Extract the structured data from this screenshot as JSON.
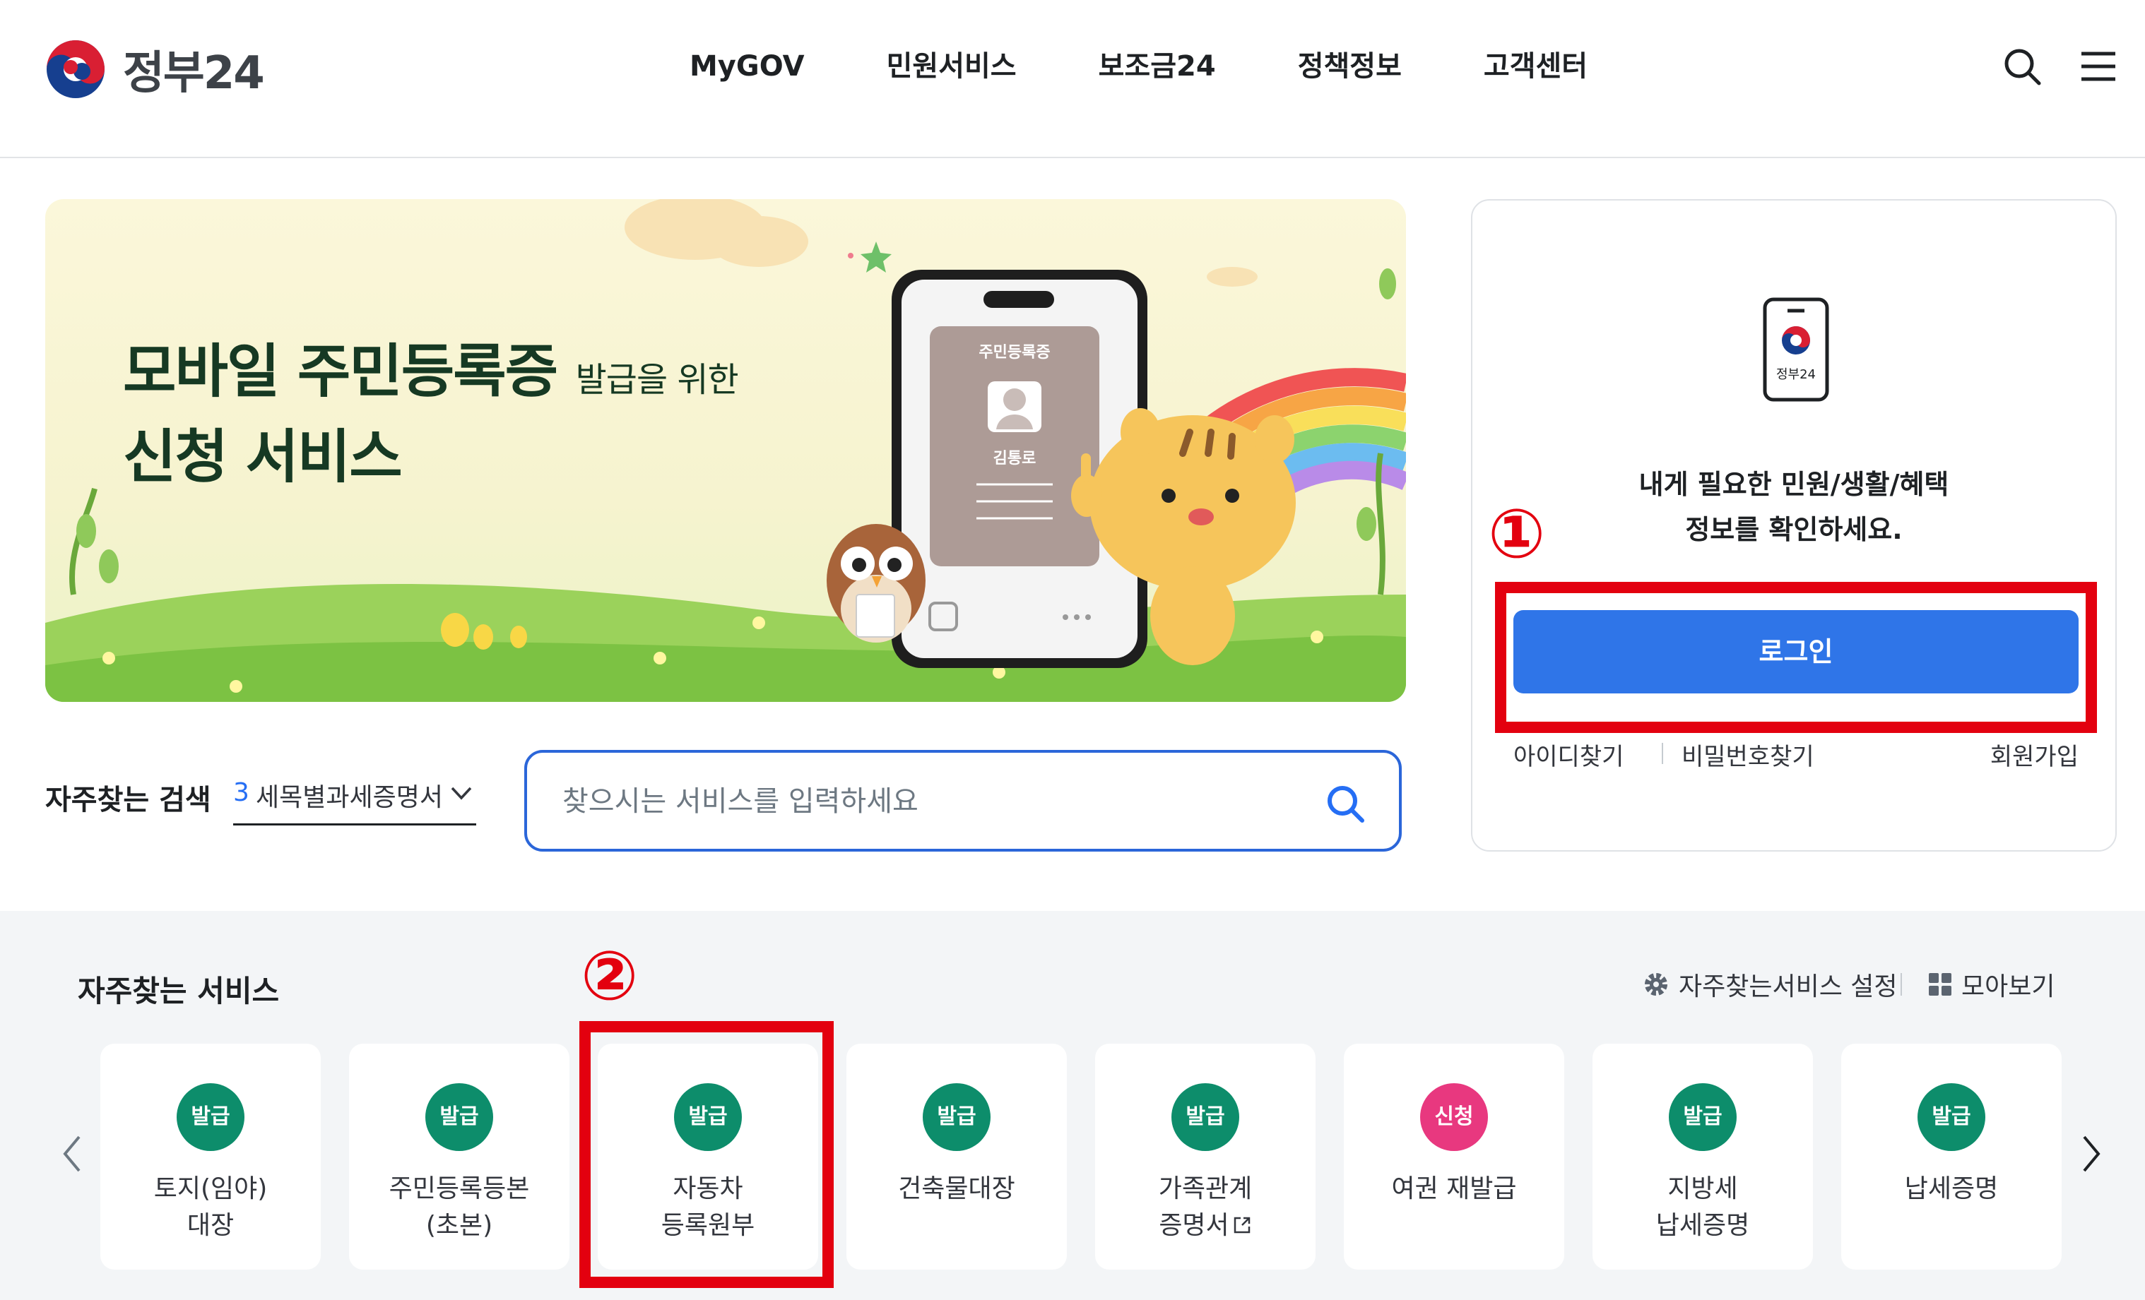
{
  "header": {
    "logo_text": "정부24",
    "nav": [
      "MyGOV",
      "민원서비스",
      "보조금24",
      "정책정보",
      "고객센터"
    ],
    "icons": [
      "search-icon",
      "menu-icon"
    ]
  },
  "banner": {
    "title_line1": "모바일 주민등록증",
    "title_line1_small": "발급을 위한",
    "title_line2": "신청 서비스",
    "card_title": "주민등록증",
    "card_name": "김통로"
  },
  "frequent_search": {
    "label": "자주찾는 검색",
    "rank": "3",
    "term": "세목별과세증명서",
    "placeholder": "찾으시는 서비스를 입력하세요"
  },
  "login": {
    "phone_icon_text": "정부24",
    "message_line1": "내게 필요한 민원/생활/혜택",
    "message_line2": "정보를 확인하세요.",
    "button": "로그인",
    "find_id": "아이디찾기",
    "find_pw": "비밀번호찾기",
    "signup": "회원가입"
  },
  "services": {
    "title": "자주찾는 서비스",
    "setting": "자주찾는서비스 설정",
    "more": "모아보기",
    "items": [
      {
        "badge": "발급",
        "label": "토지(임야)\n대장"
      },
      {
        "badge": "발급",
        "label": "주민등록등본\n(초본)"
      },
      {
        "badge": "발급",
        "label": "자동차\n등록원부"
      },
      {
        "badge": "발급",
        "label": "건축물대장"
      },
      {
        "badge": "발급",
        "label": "가족관계\n증명서"
      },
      {
        "badge": "신청",
        "label": "여권 재발급"
      },
      {
        "badge": "발급",
        "label": "지방세\n납세증명"
      },
      {
        "badge": "발급",
        "label": "납세증명"
      }
    ]
  },
  "annotations": {
    "marker1": "①",
    "marker2": "②"
  },
  "colors": {
    "primary_blue": "#2f75e8",
    "issue_badge": "#0d8d6b",
    "apply_badge": "#e8387f",
    "annotation_red": "#e3000f"
  }
}
